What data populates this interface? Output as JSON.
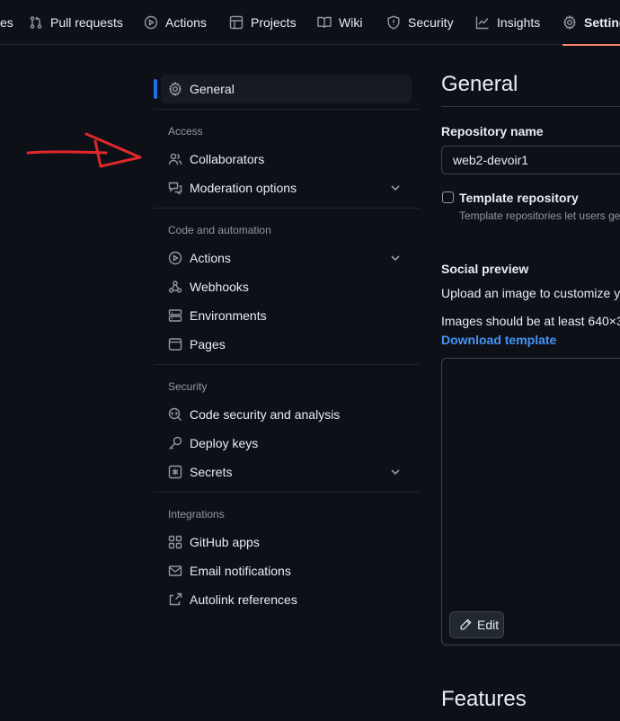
{
  "topnav": {
    "tabs": [
      {
        "label": "es",
        "icon": "none"
      },
      {
        "label": "Pull requests",
        "icon": "git-pull-request-icon"
      },
      {
        "label": "Actions",
        "icon": "play-icon"
      },
      {
        "label": "Projects",
        "icon": "table-icon"
      },
      {
        "label": "Wiki",
        "icon": "book-icon"
      },
      {
        "label": "Security",
        "icon": "shield-icon"
      },
      {
        "label": "Insights",
        "icon": "graph-icon"
      },
      {
        "label": "Settings",
        "icon": "gear-icon",
        "active": true
      }
    ],
    "accent_color": "#f78166"
  },
  "sidebar": {
    "general": "General",
    "groups": {
      "access": "Access",
      "code_automation": "Code and automation",
      "security": "Security",
      "integrations": "Integrations"
    },
    "items": {
      "collaborators": "Collaborators",
      "moderation": "Moderation options",
      "actions": "Actions",
      "webhooks": "Webhooks",
      "environments": "Environments",
      "pages": "Pages",
      "code_security": "Code security and analysis",
      "deploy_keys": "Deploy keys",
      "secrets": "Secrets",
      "github_apps": "GitHub apps",
      "email_notifications": "Email notifications",
      "autolink": "Autolink references"
    },
    "active_color": "#1f6feb"
  },
  "main": {
    "title": "General",
    "repo_name_label": "Repository name",
    "repo_name_value": "web2-devoir1",
    "template_label": "Template repository",
    "template_note": "Template repositories let users gen",
    "social_preview_label": "Social preview",
    "upload_text": "Upload an image to customize yo",
    "size_text": "Images should be at least 640×3",
    "download_link": "Download template",
    "edit_button": "Edit",
    "features_title": "Features"
  },
  "annotation": {
    "arrow_color": "#e0272b"
  }
}
